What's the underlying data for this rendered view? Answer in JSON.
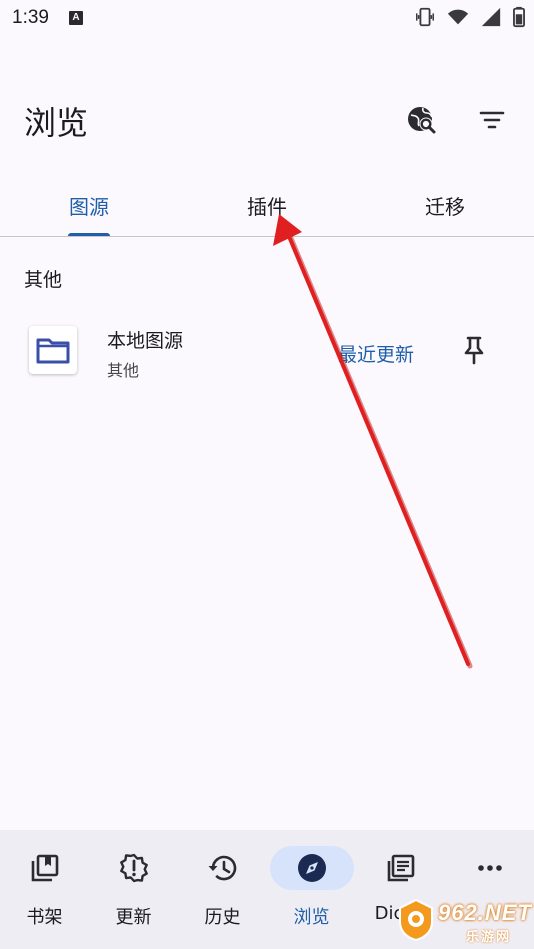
{
  "status_bar": {
    "time": "1:39",
    "notification_icon_letter": "A",
    "icons": [
      "vibrate-icon",
      "wifi-icon",
      "signal-icon",
      "battery-icon"
    ]
  },
  "header": {
    "title": "浏览",
    "actions": [
      "global-search-icon",
      "filter-icon"
    ]
  },
  "tabs": [
    {
      "label": "图源",
      "active": true
    },
    {
      "label": "插件",
      "active": false
    },
    {
      "label": "迁移",
      "active": false
    }
  ],
  "section": {
    "title": "其他",
    "sources": [
      {
        "name": "本地图源",
        "language": "其他",
        "action_label": "最近更新",
        "icon": "folder-icon",
        "pin_icon": "pin-icon"
      }
    ]
  },
  "bottom_nav": {
    "items": [
      {
        "label": "书架",
        "icon": "library-icon",
        "active": false
      },
      {
        "label": "更新",
        "icon": "updates-icon",
        "active": false
      },
      {
        "label": "历史",
        "icon": "history-icon",
        "active": false
      },
      {
        "label": "浏览",
        "icon": "compass-icon",
        "active": true
      },
      {
        "label": "Dictio",
        "icon": "dictionary-icon",
        "active": false
      },
      {
        "label": "",
        "icon": "more-icon",
        "active": false
      }
    ]
  },
  "watermark": {
    "logo_text": "962.NET",
    "sub_text": "乐游网"
  },
  "colors": {
    "accent": "#1f5ea8",
    "background": "#fcf9fe",
    "nav_background": "#efedf4",
    "annotation_arrow": "#e02020"
  }
}
